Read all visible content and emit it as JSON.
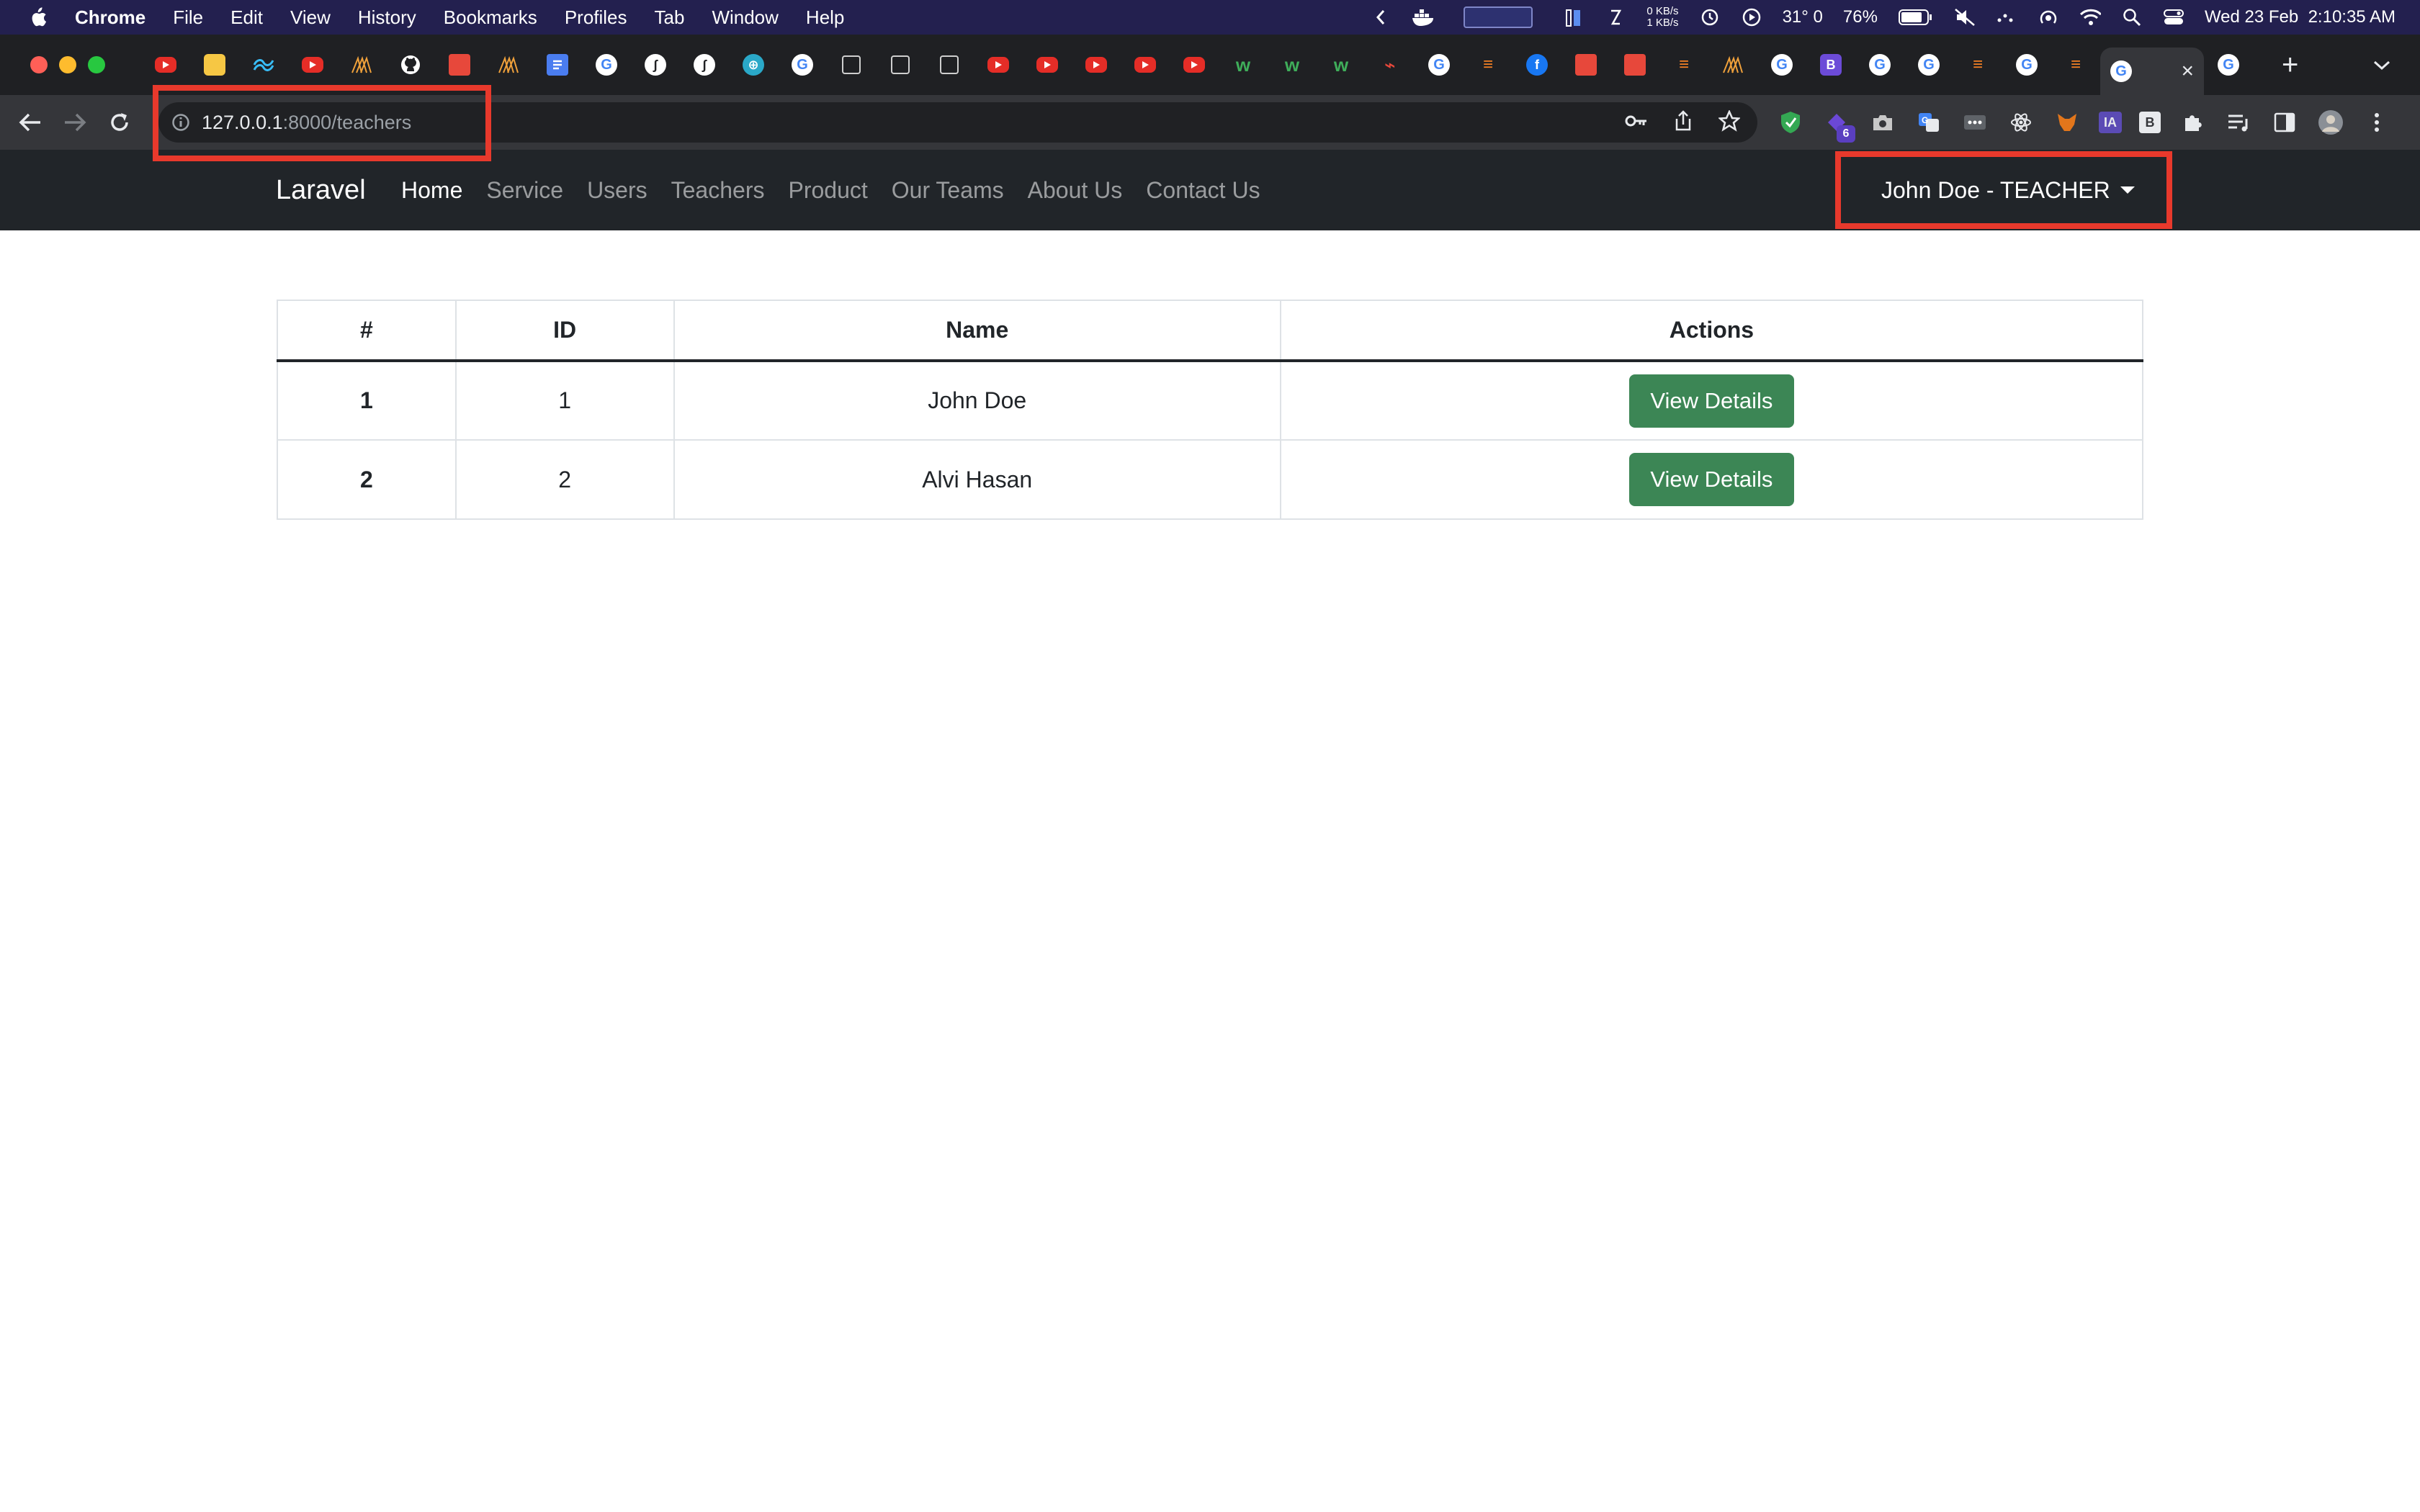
{
  "menubar": {
    "app_name": "Chrome",
    "items": [
      "File",
      "Edit",
      "View",
      "History",
      "Bookmarks",
      "Profiles",
      "Tab",
      "Window",
      "Help"
    ],
    "net_up": "0 KB/s",
    "net_down": "1 KB/s",
    "temperature": "31°",
    "temp_extra": "0",
    "battery": "76%",
    "datetime": "Wed 23 Feb  2:10:35 AM"
  },
  "browser": {
    "url_host": "127.0.0.1",
    "url_path": ":8000/teachers",
    "ext_badge": "6",
    "ext_ia_label": "IA",
    "ext_b_label": "B",
    "new_tab_symbol": "+",
    "close_symbol": "×",
    "tab_b_label": "B"
  },
  "app": {
    "brand": "Laravel",
    "nav": [
      {
        "label": "Home",
        "active": true
      },
      {
        "label": "Service"
      },
      {
        "label": "Users"
      },
      {
        "label": "Teachers"
      },
      {
        "label": "Product"
      },
      {
        "label": "Our Teams"
      },
      {
        "label": "About Us"
      },
      {
        "label": "Contact Us"
      }
    ],
    "user_menu": "John Doe - TEACHER"
  },
  "table": {
    "headers": [
      "#",
      "ID",
      "Name",
      "Actions"
    ],
    "rows": [
      {
        "num": "1",
        "id": "1",
        "name": "John Doe",
        "action": "View Details"
      },
      {
        "num": "2",
        "id": "2",
        "name": "Alvi Hasan",
        "action": "View Details"
      }
    ]
  },
  "colors": {
    "highlight": "#e8392c",
    "navbar_bg": "#212529",
    "button_success": "#3c8655"
  }
}
